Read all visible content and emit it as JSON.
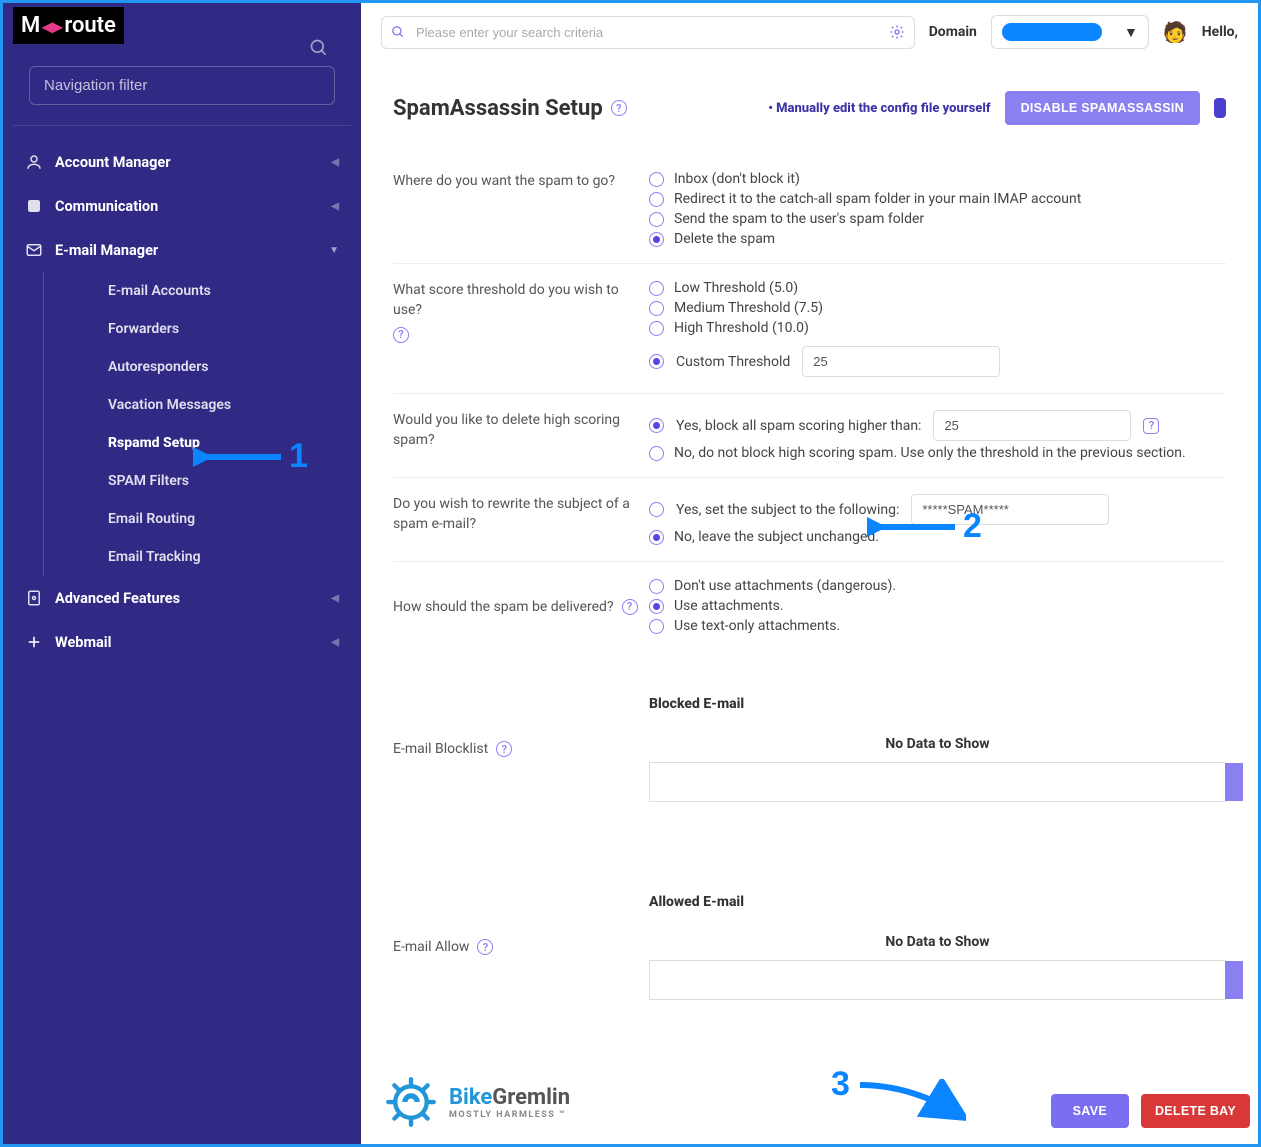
{
  "brand": {
    "name_left": "M",
    "name_right": "route"
  },
  "sidebar": {
    "filter_placeholder": "Navigation filter",
    "items": [
      {
        "label": "Account Manager"
      },
      {
        "label": "Communication"
      },
      {
        "label": "E-mail Manager"
      },
      {
        "label": "Advanced Features"
      },
      {
        "label": "Webmail"
      }
    ],
    "email_sub": [
      {
        "label": "E-mail Accounts"
      },
      {
        "label": "Forwarders"
      },
      {
        "label": "Autoresponders"
      },
      {
        "label": "Vacation Messages"
      },
      {
        "label": "Rspamd Setup"
      },
      {
        "label": "SPAM Filters"
      },
      {
        "label": "Email Routing"
      },
      {
        "label": "Email Tracking"
      }
    ]
  },
  "topbar": {
    "search_placeholder": "Please enter your search criteria",
    "domain_label": "Domain",
    "hello": "Hello,"
  },
  "page": {
    "title": "SpamAssassin Setup",
    "manual_link": "• Manually edit the config file yourself",
    "disable_btn": "DISABLE SPAMASSASSIN"
  },
  "q_spam_go": {
    "label": "Where do you want the spam to go?",
    "opts": [
      "Inbox (don't block it)",
      "Redirect it to the catch-all spam folder in your main IMAP account",
      "Send the spam to the user's spam folder",
      "Delete the spam"
    ]
  },
  "q_threshold": {
    "label": "What score threshold do you wish to use?",
    "opts": [
      "Low Threshold (5.0)",
      "Medium Threshold (7.5)",
      "High Threshold (10.0)",
      "Custom Threshold"
    ],
    "custom_value": "25"
  },
  "q_highscore": {
    "label": "Would you like to delete high scoring spam?",
    "yes": "Yes, block all spam scoring higher than:",
    "yes_value": "25",
    "no": "No, do not block high scoring spam. Use only the threshold in the previous section."
  },
  "q_rewrite": {
    "label": "Do you wish to rewrite the subject of a spam e-mail?",
    "yes": "Yes, set the subject to the following:",
    "yes_value": "*****SPAM*****",
    "no": "No, leave the subject unchanged."
  },
  "q_deliver": {
    "label": "How should the spam be delivered?",
    "opts": [
      "Don't use attachments (dangerous).",
      "Use attachments.",
      "Use text-only attachments."
    ]
  },
  "blocklist": {
    "label": "E-mail Blocklist",
    "heading": "Blocked E-mail",
    "empty": "No Data to Show"
  },
  "allowlist": {
    "label": "E-mail Allow",
    "heading": "Allowed E-mail",
    "empty": "No Data to Show"
  },
  "footer": {
    "brand1": "Bike",
    "brand2": "Gremlin",
    "tag": "MOSTLY HARMLESS ™",
    "save": "SAVE",
    "delete": "DELETE BAY"
  },
  "annotations": {
    "a1": "1",
    "a2": "2",
    "a3": "3"
  }
}
